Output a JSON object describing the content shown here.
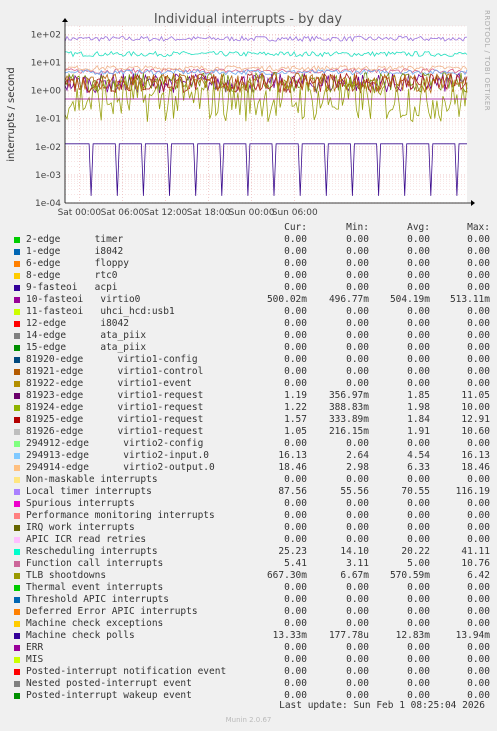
{
  "chart_data": {
    "type": "line",
    "title": "Individual interrupts - by day",
    "ylabel": "interrupts / second",
    "yscale": "log",
    "ylim": [
      0.0001,
      200
    ],
    "y_ticks": [
      "1e+02",
      "1e+01",
      "1e+00",
      "1e-01",
      "1e-02",
      "1e-03",
      "1e-04"
    ],
    "x_ticks": [
      "Sat 00:00",
      "Sat 06:00",
      "Sat 12:00",
      "Sat 18:00",
      "Sun 00:00",
      "Sun 06:00"
    ],
    "grid": true,
    "side_label": "RRDTOOL / TOBI OETIKER",
    "series_bands": [
      {
        "name": "Local timer interrupts",
        "color": "#9c75e0",
        "level": 70.55
      },
      {
        "name": "Rescheduling interrupts",
        "color": "#21e0c0",
        "level": 20.22
      },
      {
        "name": "Function call interrupts",
        "color": "#d7608a",
        "level": 5.0
      },
      {
        "name": "294913-edge",
        "color": "#6dabf0",
        "level": 4.54
      },
      {
        "name": "294914-edge",
        "color": "#f0b48a",
        "level": 6.33
      },
      {
        "name": "81923-edge",
        "color": "#720093",
        "level": 1.85
      },
      {
        "name": "81924-edge",
        "color": "#738e0c",
        "level": 1.98
      },
      {
        "name": "81925-edge",
        "color": "#ae1b1b",
        "level": 1.84
      },
      {
        "name": "81926-edge",
        "color": "#b5680f",
        "level": 1.91
      },
      {
        "name": "TLB shootdowns",
        "color": "#9aa314",
        "level": 0.57
      },
      {
        "name": "Machine check polls",
        "color": "#3b0c8e",
        "level": 0.01283
      }
    ]
  },
  "legend": {
    "headers": {
      "cur": "Cur:",
      "min": "Min:",
      "avg": "Avg:",
      "max": "Max:"
    },
    "rows": [
      {
        "label": "2-edge      timer",
        "color": "#00cc00",
        "cur": "0.00",
        "min": "0.00",
        "avg": "0.00",
        "max": "0.00"
      },
      {
        "label": "1-edge      i8042",
        "color": "#0066b3",
        "cur": "0.00",
        "min": "0.00",
        "avg": "0.00",
        "max": "0.00"
      },
      {
        "label": "6-edge      floppy",
        "color": "#ff8000",
        "cur": "0.00",
        "min": "0.00",
        "avg": "0.00",
        "max": "0.00"
      },
      {
        "label": "8-edge      rtc0",
        "color": "#ffcc00",
        "cur": "0.00",
        "min": "0.00",
        "avg": "0.00",
        "max": "0.00"
      },
      {
        "label": "9-fasteoi   acpi",
        "color": "#330099",
        "cur": "0.00",
        "min": "0.00",
        "avg": "0.00",
        "max": "0.00"
      },
      {
        "label": "10-fasteoi   virtio0",
        "color": "#990099",
        "cur": "500.02m",
        "min": "496.77m",
        "avg": "504.19m",
        "max": "513.11m"
      },
      {
        "label": "11-fasteoi   uhci_hcd:usb1",
        "color": "#ccff00",
        "cur": "0.00",
        "min": "0.00",
        "avg": "0.00",
        "max": "0.00"
      },
      {
        "label": "12-edge      i8042",
        "color": "#ff0000",
        "cur": "0.00",
        "min": "0.00",
        "avg": "0.00",
        "max": "0.00"
      },
      {
        "label": "14-edge      ata_piix",
        "color": "#808080",
        "cur": "0.00",
        "min": "0.00",
        "avg": "0.00",
        "max": "0.00"
      },
      {
        "label": "15-edge      ata_piix",
        "color": "#008f00",
        "cur": "0.00",
        "min": "0.00",
        "avg": "0.00",
        "max": "0.00"
      },
      {
        "label": "81920-edge      virtio1-config",
        "color": "#00487d",
        "cur": "0.00",
        "min": "0.00",
        "avg": "0.00",
        "max": "0.00"
      },
      {
        "label": "81921-edge      virtio1-control",
        "color": "#b35a00",
        "cur": "0.00",
        "min": "0.00",
        "avg": "0.00",
        "max": "0.00"
      },
      {
        "label": "81922-edge      virtio1-event",
        "color": "#b38f00",
        "cur": "0.00",
        "min": "0.00",
        "avg": "0.00",
        "max": "0.00"
      },
      {
        "label": "81923-edge      virtio1-request",
        "color": "#6b006b",
        "cur": "1.19",
        "min": "356.97m",
        "avg": "1.85",
        "max": "11.05"
      },
      {
        "label": "81924-edge      virtio1-request",
        "color": "#8fb300",
        "cur": "1.22",
        "min": "388.83m",
        "avg": "1.98",
        "max": "10.00"
      },
      {
        "label": "81925-edge      virtio1-request",
        "color": "#b30000",
        "cur": "1.57",
        "min": "333.89m",
        "avg": "1.84",
        "max": "12.91"
      },
      {
        "label": "81926-edge      virtio1-request",
        "color": "#bebebe",
        "cur": "1.05",
        "min": "216.15m",
        "avg": "1.91",
        "max": "10.60"
      },
      {
        "label": "294912-edge      virtio2-config",
        "color": "#80ff80",
        "cur": "0.00",
        "min": "0.00",
        "avg": "0.00",
        "max": "0.00"
      },
      {
        "label": "294913-edge      virtio2-input.0",
        "color": "#80c9ff",
        "cur": "16.13",
        "min": "2.64",
        "avg": "4.54",
        "max": "16.13"
      },
      {
        "label": "294914-edge      virtio2-output.0",
        "color": "#ffc080",
        "cur": "18.46",
        "min": "2.98",
        "avg": "6.33",
        "max": "18.46"
      },
      {
        "label": "Non-maskable interrupts",
        "color": "#ffe680",
        "cur": "0.00",
        "min": "0.00",
        "avg": "0.00",
        "max": "0.00"
      },
      {
        "label": "Local timer interrupts",
        "color": "#aa80ff",
        "cur": "87.56",
        "min": "55.56",
        "avg": "70.55",
        "max": "116.19"
      },
      {
        "label": "Spurious interrupts",
        "color": "#ee00cc",
        "cur": "0.00",
        "min": "0.00",
        "avg": "0.00",
        "max": "0.00"
      },
      {
        "label": "Performance monitoring interrupts",
        "color": "#ff8080",
        "cur": "0.00",
        "min": "0.00",
        "avg": "0.00",
        "max": "0.00"
      },
      {
        "label": "IRQ work interrupts",
        "color": "#666600",
        "cur": "0.00",
        "min": "0.00",
        "avg": "0.00",
        "max": "0.00"
      },
      {
        "label": "APIC ICR read retries",
        "color": "#ffbfff",
        "cur": "0.00",
        "min": "0.00",
        "avg": "0.00",
        "max": "0.00"
      },
      {
        "label": "Rescheduling interrupts",
        "color": "#00ffcc",
        "cur": "25.23",
        "min": "14.10",
        "avg": "20.22",
        "max": "41.11"
      },
      {
        "label": "Function call interrupts",
        "color": "#cc6699",
        "cur": "5.41",
        "min": "3.11",
        "avg": "5.00",
        "max": "10.76"
      },
      {
        "label": "TLB shootdowns",
        "color": "#999900",
        "cur": "667.30m",
        "min": "6.67m",
        "avg": "570.59m",
        "max": "6.42"
      },
      {
        "label": "Thermal event interrupts",
        "color": "#00cc00",
        "cur": "0.00",
        "min": "0.00",
        "avg": "0.00",
        "max": "0.00"
      },
      {
        "label": "Threshold APIC interrupts",
        "color": "#0066b3",
        "cur": "0.00",
        "min": "0.00",
        "avg": "0.00",
        "max": "0.00"
      },
      {
        "label": "Deferred Error APIC interrupts",
        "color": "#ff8000",
        "cur": "0.00",
        "min": "0.00",
        "avg": "0.00",
        "max": "0.00"
      },
      {
        "label": "Machine check exceptions",
        "color": "#ffcc00",
        "cur": "0.00",
        "min": "0.00",
        "avg": "0.00",
        "max": "0.00"
      },
      {
        "label": "Machine check polls",
        "color": "#330099",
        "cur": "13.33m",
        "min": "177.78u",
        "avg": "12.83m",
        "max": "13.94m"
      },
      {
        "label": "ERR",
        "color": "#990099",
        "cur": "0.00",
        "min": "0.00",
        "avg": "0.00",
        "max": "0.00"
      },
      {
        "label": "MIS",
        "color": "#ccff00",
        "cur": "0.00",
        "min": "0.00",
        "avg": "0.00",
        "max": "0.00"
      },
      {
        "label": "Posted-interrupt notification event",
        "color": "#ff0000",
        "cur": "0.00",
        "min": "0.00",
        "avg": "0.00",
        "max": "0.00"
      },
      {
        "label": "Nested posted-interrupt event",
        "color": "#808080",
        "cur": "0.00",
        "min": "0.00",
        "avg": "0.00",
        "max": "0.00"
      },
      {
        "label": "Posted-interrupt wakeup event",
        "color": "#008f00",
        "cur": "0.00",
        "min": "0.00",
        "avg": "0.00",
        "max": "0.00"
      }
    ]
  },
  "footer": {
    "last_update": "Last update: Sun Feb  1 08:25:04 2026",
    "munin": "Munin 2.0.67"
  }
}
